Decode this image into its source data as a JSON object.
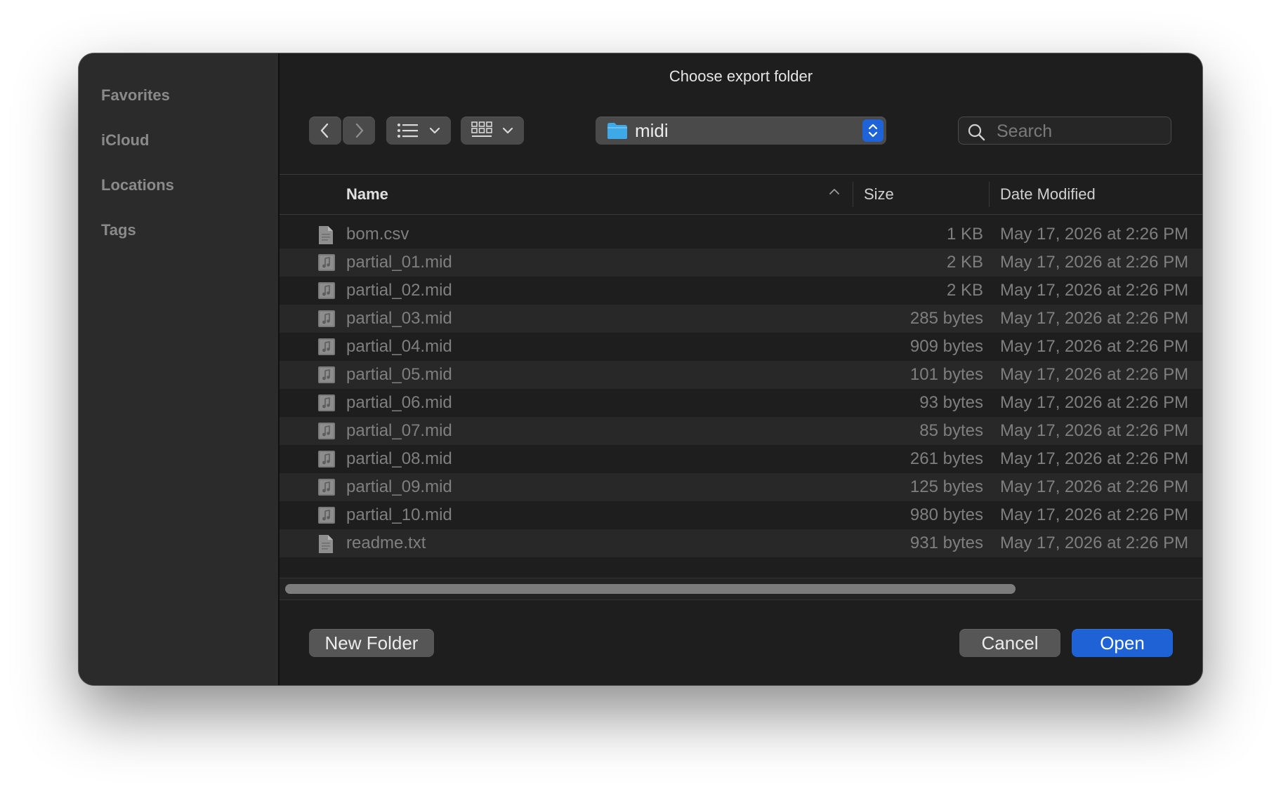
{
  "dialog": {
    "title": "Choose export folder"
  },
  "sidebar": {
    "items": [
      {
        "label": "Favorites"
      },
      {
        "label": "iCloud"
      },
      {
        "label": "Locations"
      },
      {
        "label": "Tags"
      }
    ]
  },
  "toolbar": {
    "back_icon": "chevron-left-icon",
    "forward_icon": "chevron-right-icon",
    "list_view_icon": "list-icon",
    "icon_view_icon": "grid-icon",
    "current_folder": "midi",
    "folder_color": "#3fa9e8",
    "accent_color": "#1f63d9"
  },
  "search": {
    "placeholder": "Search",
    "value": ""
  },
  "table": {
    "columns": {
      "name": "Name",
      "size": "Size",
      "date": "Date Modified"
    },
    "sort": "name-ascending",
    "rows": [
      {
        "name": "bom.csv",
        "size": "1 KB",
        "date": "May 17, 2026 at 2:26 PM",
        "icon": "document-icon"
      },
      {
        "name": "partial_01.mid",
        "size": "2 KB",
        "date": "May 17, 2026 at 2:26 PM",
        "icon": "music-file-icon"
      },
      {
        "name": "partial_02.mid",
        "size": "2 KB",
        "date": "May 17, 2026 at 2:26 PM",
        "icon": "music-file-icon"
      },
      {
        "name": "partial_03.mid",
        "size": "285 bytes",
        "date": "May 17, 2026 at 2:26 PM",
        "icon": "music-file-icon"
      },
      {
        "name": "partial_04.mid",
        "size": "909 bytes",
        "date": "May 17, 2026 at 2:26 PM",
        "icon": "music-file-icon"
      },
      {
        "name": "partial_05.mid",
        "size": "101 bytes",
        "date": "May 17, 2026 at 2:26 PM",
        "icon": "music-file-icon"
      },
      {
        "name": "partial_06.mid",
        "size": "93 bytes",
        "date": "May 17, 2026 at 2:26 PM",
        "icon": "music-file-icon"
      },
      {
        "name": "partial_07.mid",
        "size": "85 bytes",
        "date": "May 17, 2026 at 2:26 PM",
        "icon": "music-file-icon"
      },
      {
        "name": "partial_08.mid",
        "size": "261 bytes",
        "date": "May 17, 2026 at 2:26 PM",
        "icon": "music-file-icon"
      },
      {
        "name": "partial_09.mid",
        "size": "125 bytes",
        "date": "May 17, 2026 at 2:26 PM",
        "icon": "music-file-icon"
      },
      {
        "name": "partial_10.mid",
        "size": "980 bytes",
        "date": "May 17, 2026 at 2:26 PM",
        "icon": "music-file-icon"
      },
      {
        "name": "readme.txt",
        "size": "931 bytes",
        "date": "May 17, 2026 at 2:26 PM",
        "icon": "document-icon"
      }
    ]
  },
  "buttons": {
    "new_folder": "New Folder",
    "cancel": "Cancel",
    "open": "Open"
  }
}
